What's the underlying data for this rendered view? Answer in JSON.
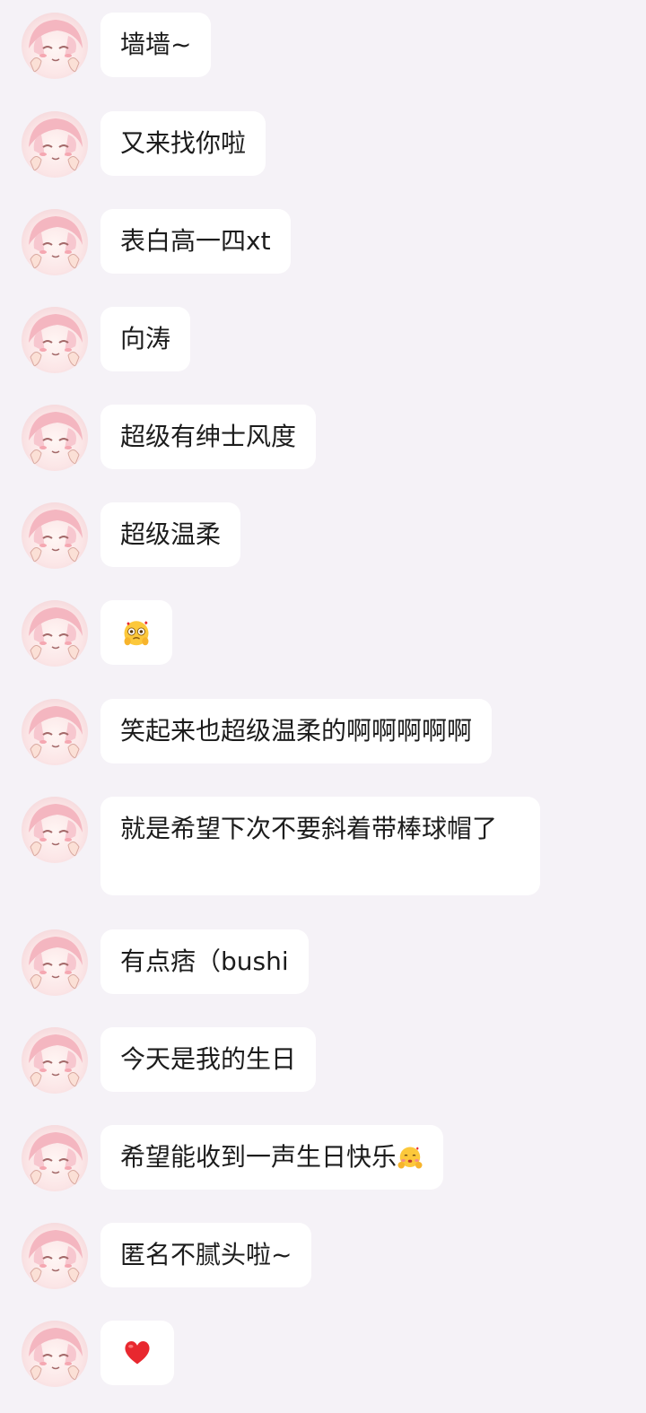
{
  "messages": [
    {
      "text": "墙墙~"
    },
    {
      "text": "又来找你啦"
    },
    {
      "text": "表白高一四xt"
    },
    {
      "text": "向涛"
    },
    {
      "text": "超级有绅士风度"
    },
    {
      "text": "超级温柔"
    },
    {
      "text": "",
      "emoji": "pleading-hearts-emoji"
    },
    {
      "text": "笑起来也超级温柔的啊啊啊啊啊"
    },
    {
      "text": "就是希望下次不要斜着带棒球帽了"
    },
    {
      "text": "有点痞（bushi"
    },
    {
      "text": "今天是我的生日"
    },
    {
      "text": "希望能收到一声生日快乐",
      "emoji": "cheeks-hands-emoji"
    },
    {
      "text": "匿名不腻头啦~"
    },
    {
      "text": "",
      "emoji": "red-heart-emoji"
    }
  ],
  "colors": {
    "background": "#f5f2f7",
    "bubble": "#ffffff",
    "text": "#1c1c1c",
    "avatar_hair": "#f4b6c0",
    "heart": "#e8282f",
    "emoji_yellow": "#fcc83b"
  }
}
